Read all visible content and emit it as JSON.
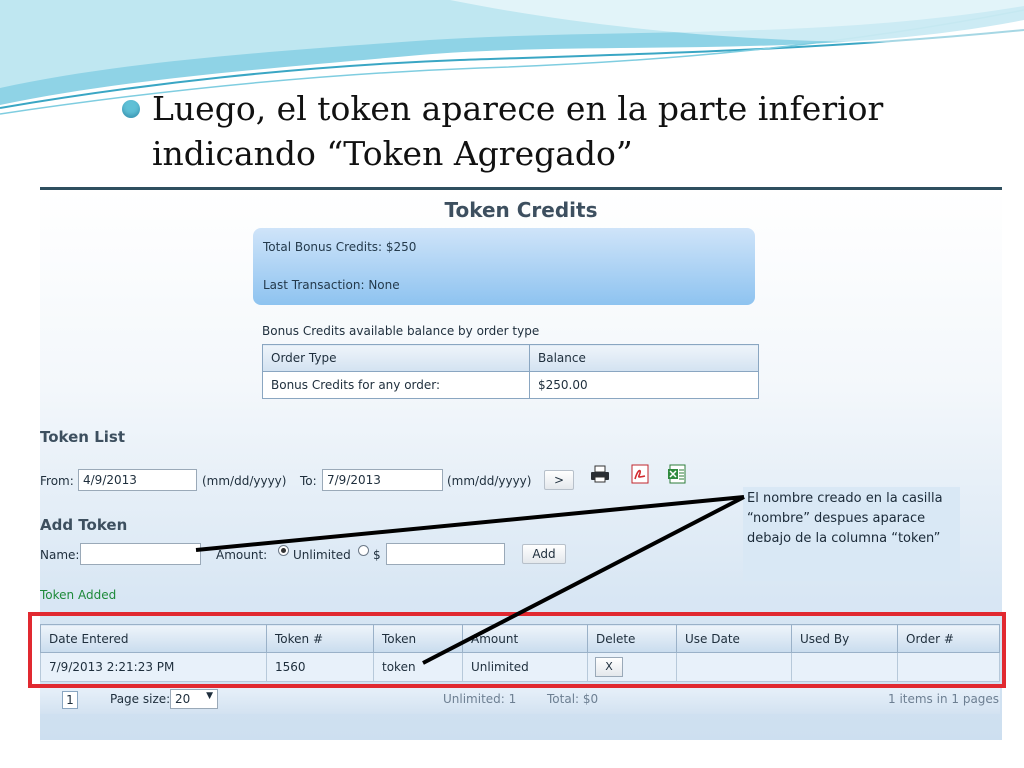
{
  "slide": {
    "bullet_line1": "Luego, el token aparece en la parte inferior",
    "bullet_line2": "indicando “Token Agregado”"
  },
  "page": {
    "title": "Token Credits",
    "total_bonus": "Total Bonus Credits: $250",
    "last_transaction": "Last Transaction: None",
    "available_caption": "Bonus Credits available balance by order type",
    "balance_table": {
      "headers": [
        "Order Type",
        "Balance"
      ],
      "rows": [
        [
          "Bonus Credits for any order:",
          "$250.00"
        ]
      ]
    }
  },
  "token_list": {
    "heading": "Token List",
    "from_label": "From:",
    "from_value": "4/9/2013",
    "date_hint_1": "(mm/dd/yyyy)",
    "to_label": "To:",
    "to_value": "7/9/2013",
    "date_hint_2": "(mm/dd/yyyy)",
    "go_label": ">",
    "icons": [
      "printer-icon",
      "pdf-icon",
      "excel-icon"
    ]
  },
  "add_token": {
    "heading": "Add Token",
    "name_label": "Name:",
    "name_value": "",
    "amount_label": "Amount:",
    "unlimited_label": "Unlimited",
    "dollar_label": "$",
    "amount_value": "",
    "add_label": "Add",
    "status": "Token Added"
  },
  "annotation": {
    "line1": "El nombre creado en la casilla",
    "line2": "“nombre”  despues aparace",
    "line3": "debajo de la columna “token”"
  },
  "grid": {
    "headers": [
      "Date Entered",
      "Token #",
      "Token",
      "Amount",
      "Delete",
      "Use Date",
      "Used By",
      "Order #"
    ],
    "row": {
      "date_entered": "7/9/2013 2:21:23 PM",
      "token_number": "1560",
      "token": "token",
      "amount": "Unlimited",
      "delete_label": "X",
      "use_date": "",
      "used_by": "",
      "order_number": ""
    }
  },
  "pager": {
    "current_page": "1",
    "page_size_label": "Page size:",
    "page_size_value": "20",
    "unlimited_summary": "Unlimited:  1",
    "total_summary": "Total:  $0",
    "items_summary": "1 items in 1 pages"
  },
  "colors": {
    "highlight_box": "#e12930",
    "status_text": "#1e8a3a",
    "accent_wave": "#5fc0d6"
  }
}
